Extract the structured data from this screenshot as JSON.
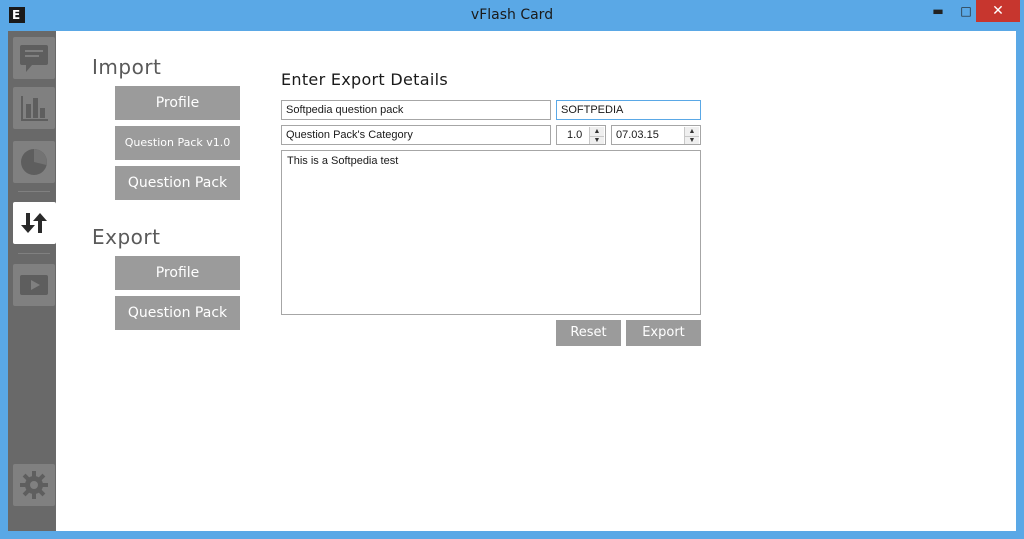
{
  "window": {
    "app_icon": "E",
    "title": "vFlash Card",
    "min_glyph": "▬",
    "max_glyph": "□",
    "close_glyph": "✕"
  },
  "sidebar": {
    "items": [
      {
        "icon": "chat-bubble-icon",
        "active": false
      },
      {
        "icon": "bar-chart-icon",
        "active": false
      },
      {
        "icon": "pie-chart-icon",
        "active": false
      },
      {
        "icon": "import-export-arrows-icon",
        "active": true
      },
      {
        "icon": "play-video-icon",
        "active": false
      },
      {
        "icon": "gear-icon",
        "active": false
      }
    ]
  },
  "import": {
    "heading": "Import",
    "buttons": [
      "Profile",
      "Question Pack v1.0",
      "Question Pack"
    ]
  },
  "export": {
    "heading": "Export",
    "buttons": [
      "Profile",
      "Question Pack"
    ]
  },
  "form": {
    "title": "Enter Export Details",
    "name_value": "Softpedia question pack",
    "author_value": "SOFTPEDIA",
    "category_value": "Question Pack's Category",
    "version_value": "1.0",
    "date_value": "07.03.15",
    "description_value": "This is a Softpedia test",
    "reset_label": "Reset",
    "export_label": "Export"
  },
  "colors": {
    "titlebar": "#5aa8e6",
    "sidebar": "#696969",
    "button": "#9b9b9b",
    "close": "#c7362e"
  }
}
